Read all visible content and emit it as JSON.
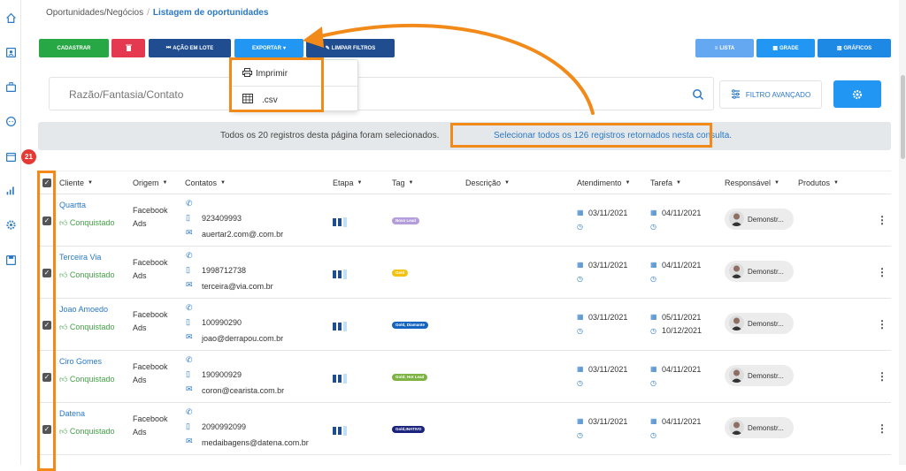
{
  "breadcrumb": {
    "parent": "Oportunidades/Negócios",
    "separator": "/",
    "current": "Listagem de oportunidades"
  },
  "sidebar": {
    "badge": "21",
    "icons": [
      "home-icon",
      "contacts-icon",
      "briefcase-icon",
      "chat-icon",
      "calendar-icon",
      "chart-icon",
      "settings-icon",
      "save-icon"
    ]
  },
  "toolbar": {
    "cadastrar": "CADASTRAR",
    "acao_lote": "AÇÃO EM LOTE",
    "exportar": "EXPORTAR",
    "limpar": "LIMPAR FILTROS",
    "lista": "LISTA",
    "grade": "GRADE",
    "graficos": "GRÁFICOS",
    "colors": {
      "green": "#28a745",
      "red": "#e53950",
      "navy": "#1f4d8f",
      "blue": "#2196f3"
    }
  },
  "export_menu": {
    "items": [
      {
        "label": "Imprimir",
        "icon": "printer-icon"
      },
      {
        "label": ".csv",
        "icon": "table-icon"
      }
    ]
  },
  "search": {
    "placeholder": "Razão/Fantasia/Contato",
    "advanced_filter": "FILTRO AVANÇADO"
  },
  "selection_banner": {
    "text": "Todos os 20 registros desta página foram selecionados.",
    "link": "Selecionar todos os 126 registros retornados nesta consulta."
  },
  "table": {
    "columns": [
      "Cliente",
      "Origem",
      "Contatos",
      "Etapa",
      "Tag",
      "Descrição",
      "Atendimento",
      "Tarefa",
      "Responsável",
      "Produtos"
    ],
    "rows": [
      {
        "cliente": "Quartta",
        "status": "Conquistado",
        "origem": "Facebook Ads",
        "phone": "923409993",
        "email": "auertar2.com@.com.br",
        "etapa": 2,
        "tag": "Novo Lead",
        "tag_color": "#b39ddb",
        "atendimento": "03/11/2021",
        "tarefa": "04/11/2021",
        "tarefa2": "",
        "responsavel": "Demonstr..."
      },
      {
        "cliente": "Terceira Via",
        "status": "Conquistado",
        "origem": "Facebook Ads",
        "phone": "1998712738",
        "email": "terceira@via.com.br",
        "etapa": 2,
        "tag": "Gold",
        "tag_color": "#f4c20d",
        "atendimento": "03/11/2021",
        "tarefa": "04/11/2021",
        "tarefa2": "",
        "responsavel": "Demonstr..."
      },
      {
        "cliente": "Joao Amoedo",
        "status": "Conquistado",
        "origem": "Facebook Ads",
        "phone": "100990290",
        "email": "joao@derrapou.com.br",
        "etapa": 2,
        "tag": "Gold, Diamante",
        "tag_color": "#1565c0",
        "atendimento": "03/11/2021",
        "tarefa": "05/11/2021",
        "tarefa2": "10/12/2021",
        "responsavel": "Demonstr..."
      },
      {
        "cliente": "Ciro Gomes",
        "status": "Conquistado",
        "origem": "Facebook Ads",
        "phone": "190900929",
        "email": "coron@cearista.com.br",
        "etapa": 2,
        "tag": "Gold; Hot Lead",
        "tag_color": "#7cb342",
        "atendimento": "03/11/2021",
        "tarefa": "04/11/2021",
        "tarefa2": "",
        "responsavel": "Demonstr..."
      },
      {
        "cliente": "Datena",
        "status": "Conquistado",
        "origem": "Facebook Ads",
        "phone": "2090992099",
        "email": "medaibagens@datena.com.br",
        "etapa": 2,
        "tag": "Gold,INATIVO",
        "tag_color": "#1a237e",
        "atendimento": "03/11/2021",
        "tarefa": "04/11/2021",
        "tarefa2": "",
        "responsavel": "Demonstr..."
      }
    ]
  },
  "annotation_color": "#f28a1a"
}
